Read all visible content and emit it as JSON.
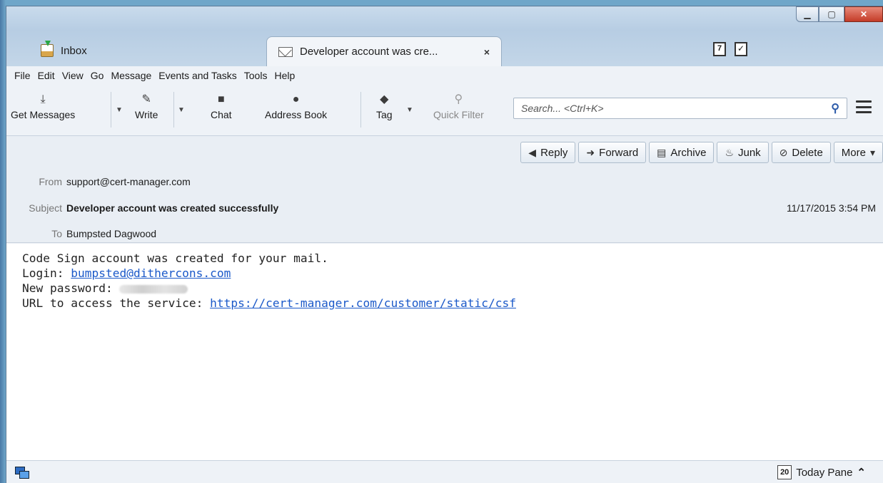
{
  "tabs": [
    {
      "label": "Inbox",
      "icon": "inbox-icon",
      "active": false
    },
    {
      "label": "Developer account was cre...",
      "icon": "envelope-icon",
      "active": true,
      "close": "×"
    }
  ],
  "calendar_icon_text": "7",
  "menu": [
    "File",
    "Edit",
    "View",
    "Go",
    "Message",
    "Events and Tasks",
    "Tools",
    "Help"
  ],
  "toolbar": {
    "get_messages": "Get Messages",
    "write": "Write",
    "chat": "Chat",
    "address_book": "Address Book",
    "tag": "Tag",
    "quick_filter": "Quick Filter",
    "search_placeholder": "Search... <Ctrl+K>"
  },
  "actions": {
    "reply": "Reply",
    "forward": "Forward",
    "archive": "Archive",
    "junk": "Junk",
    "delete": "Delete",
    "more": "More"
  },
  "header": {
    "from_label": "From",
    "from": "support@cert-manager.com",
    "subject_label": "Subject",
    "subject": "Developer account was created successfully",
    "to_label": "To",
    "to": "Bumpsted Dagwood",
    "date": "11/17/2015 3:54 PM"
  },
  "body": {
    "line1": "Code Sign account was created for your mail.",
    "login_label": "Login: ",
    "login_link": "bumpsted@dithercons.com",
    "password_label": "New password: ",
    "url_label": "URL to access the service: ",
    "url_link": "https://cert-manager.com/customer/static/csf"
  },
  "status": {
    "today_pane": "Today Pane",
    "today_date": "20"
  },
  "colors": {
    "link": "#1b59c9",
    "close_button": "#c43b27",
    "chrome": "#eef2f7"
  }
}
